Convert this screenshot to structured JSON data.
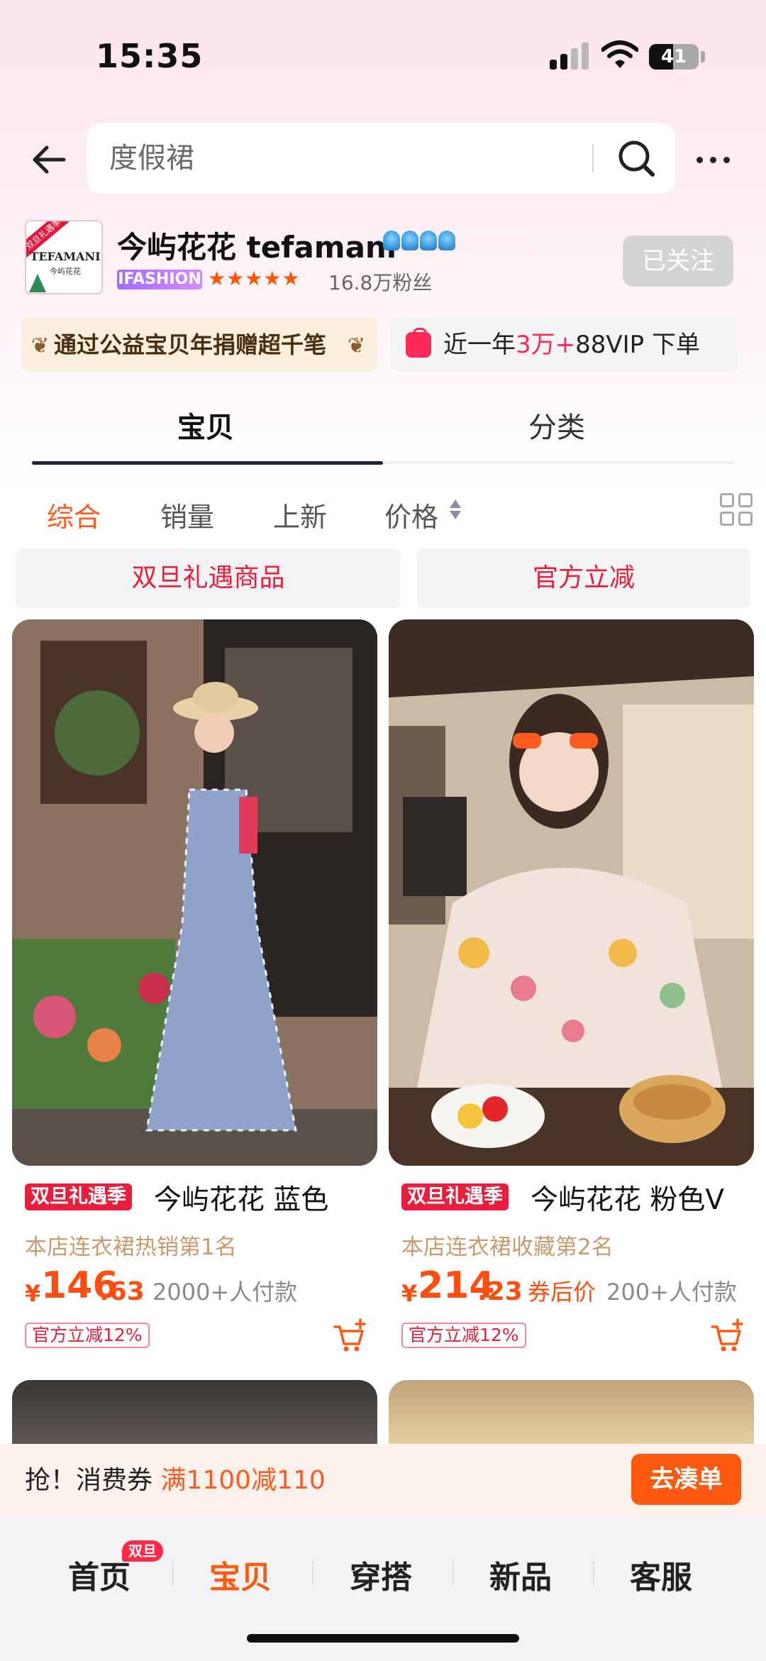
{
  "status_bar": {
    "time": "15:35",
    "battery": "41"
  },
  "search": {
    "query": "度假裙"
  },
  "shop": {
    "logo_brand": "TEFAMANI",
    "logo_sub": "今屿花花",
    "logo_ribbon": "双旦礼遇季",
    "name": "今屿花花 tefamani",
    "badge": "IFASHION",
    "stars": "★★★★★",
    "fans": "16.8万粉丝",
    "follow_label": "已关注"
  },
  "banners": {
    "charity": "通过公益宝贝年捐赠超千笔",
    "vip_prefix": "近一年",
    "vip_highlight": "3万+",
    "vip_suffix": "88VIP 下单"
  },
  "tabs": [
    {
      "label": "宝贝",
      "active": true
    },
    {
      "label": "分类",
      "active": false
    }
  ],
  "sort": [
    {
      "label": "综合",
      "active": true
    },
    {
      "label": "销量",
      "active": false
    },
    {
      "label": "上新",
      "active": false
    },
    {
      "label": "价格",
      "active": false
    }
  ],
  "chips": [
    "双旦礼遇商品",
    "官方立减"
  ],
  "products": [
    {
      "promo_tag": "双旦礼遇季",
      "title": "今屿花花 蓝色",
      "rank": "本店连衣裙热销第1名",
      "currency": "¥",
      "price_int": "146",
      "price_dec": ".63",
      "coupon_after": "",
      "paid": "2000+人付款",
      "off_tag": "官方立减12%"
    },
    {
      "promo_tag": "双旦礼遇季",
      "title": "今屿花花 粉色V",
      "rank": "本店连衣裙收藏第2名",
      "currency": "¥",
      "price_int": "214",
      "price_dec": ".23",
      "coupon_after": "券后价",
      "paid": "200+人付款",
      "off_tag": "官方立减12%"
    }
  ],
  "voucher": {
    "prefix": "抢！消费券 ",
    "highlight": "满1100减110",
    "button": "去凑单"
  },
  "bottom_nav": [
    {
      "label": "首页",
      "active": false,
      "badge": "双旦"
    },
    {
      "label": "宝贝",
      "active": true
    },
    {
      "label": "穿搭",
      "active": false
    },
    {
      "label": "新品",
      "active": false
    },
    {
      "label": "客服",
      "active": false
    }
  ],
  "colors": {
    "accent": "#ff5a10",
    "promo_red": "#e81e3c",
    "tab_indicator": "#1c2340"
  }
}
